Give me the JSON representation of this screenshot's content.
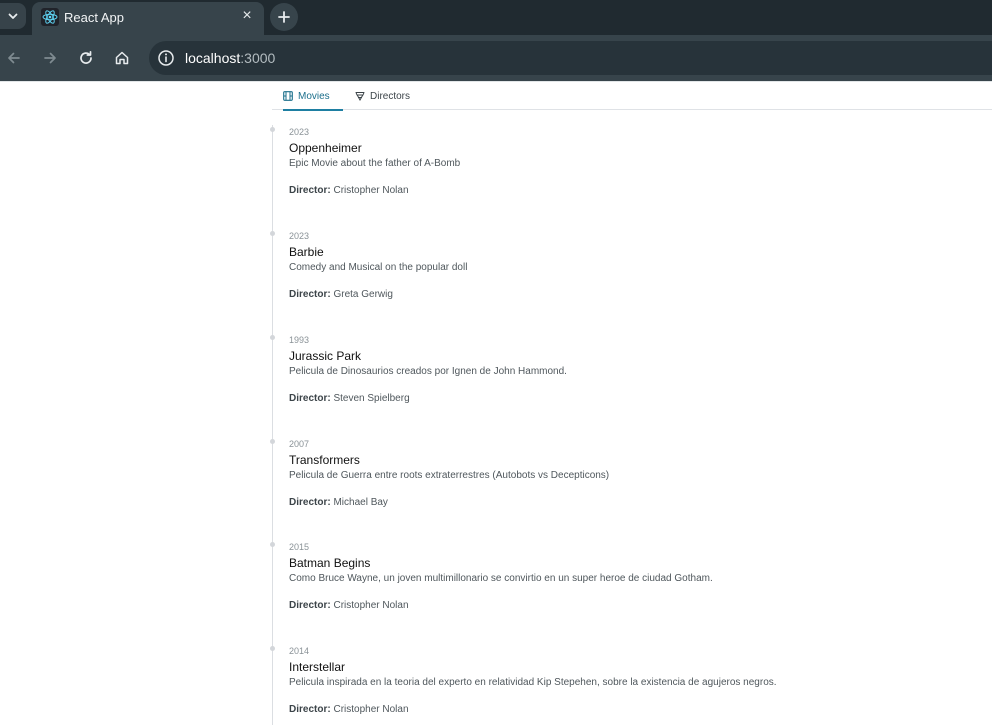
{
  "browser": {
    "tab_title": "React App",
    "url_host": "localhost",
    "url_port": ":3000"
  },
  "nav_tabs": [
    {
      "label": "Movies",
      "icon": "film-icon",
      "active": true
    },
    {
      "label": "Directors",
      "icon": "director-icon",
      "active": false
    }
  ],
  "director_label": "Director:",
  "movies": [
    {
      "year": "2023",
      "title": "Oppenheimer",
      "description": "Epic Movie about the father of A-Bomb",
      "director": "Cristopher Nolan"
    },
    {
      "year": "2023",
      "title": "Barbie",
      "description": "Comedy and Musical on the popular doll",
      "director": "Greta Gerwig"
    },
    {
      "year": "1993",
      "title": "Jurassic Park",
      "description": "Pelicula de Dinosaurios creados por Ignen de John Hammond.",
      "director": "Steven Spielberg"
    },
    {
      "year": "2007",
      "title": "Transformers",
      "description": "Pelicula de Guerra entre roots extraterrestres (Autobots vs Decepticons)",
      "director": "Michael Bay"
    },
    {
      "year": "2015",
      "title": "Batman Begins",
      "description": "Como Bruce Wayne, un joven multimillonario se convirtio en un super heroe de ciudad Gotham.",
      "director": "Cristopher Nolan"
    },
    {
      "year": "2014",
      "title": "Interstellar",
      "description": "Pelicula inspirada en la teoria del experto en relatividad Kip Stepehen, sobre la existencia de agujeros negros.",
      "director": "Cristopher Nolan"
    }
  ],
  "colors": {
    "accent": "#1e7fa2",
    "chrome_dark": "#202a30",
    "chrome_toolbar": "#37444b"
  }
}
